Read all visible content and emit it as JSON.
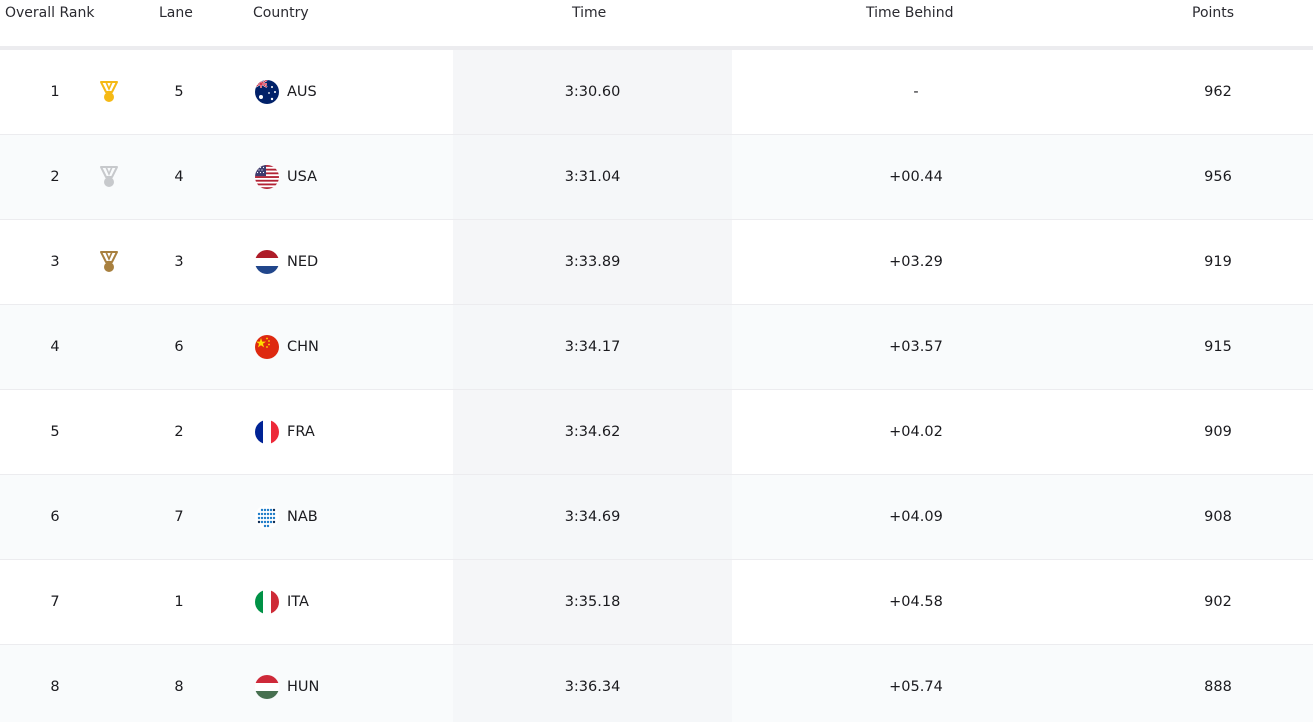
{
  "header": {
    "rank": "Overall Rank",
    "lane": "Lane",
    "country": "Country",
    "time": "Time",
    "behind": "Time Behind",
    "points": "Points"
  },
  "colors": {
    "gold": "#f5b915",
    "silver": "#c7c9cc",
    "bronze": "#a8803f"
  },
  "rows": [
    {
      "rank": "1",
      "medal": "gold",
      "lane": "5",
      "country": "AUS",
      "time": "3:30.60",
      "behind": "-",
      "points": "962"
    },
    {
      "rank": "2",
      "medal": "silver",
      "lane": "4",
      "country": "USA",
      "time": "3:31.04",
      "behind": "+00.44",
      "points": "956"
    },
    {
      "rank": "3",
      "medal": "bronze",
      "lane": "3",
      "country": "NED",
      "time": "3:33.89",
      "behind": "+03.29",
      "points": "919"
    },
    {
      "rank": "4",
      "medal": "",
      "lane": "6",
      "country": "CHN",
      "time": "3:34.17",
      "behind": "+03.57",
      "points": "915"
    },
    {
      "rank": "5",
      "medal": "",
      "lane": "2",
      "country": "FRA",
      "time": "3:34.62",
      "behind": "+04.02",
      "points": "909"
    },
    {
      "rank": "6",
      "medal": "",
      "lane": "7",
      "country": "NAB",
      "time": "3:34.69",
      "behind": "+04.09",
      "points": "908"
    },
    {
      "rank": "7",
      "medal": "",
      "lane": "1",
      "country": "ITA",
      "time": "3:35.18",
      "behind": "+04.58",
      "points": "902"
    },
    {
      "rank": "8",
      "medal": "",
      "lane": "8",
      "country": "HUN",
      "time": "3:36.34",
      "behind": "+05.74",
      "points": "888"
    }
  ]
}
